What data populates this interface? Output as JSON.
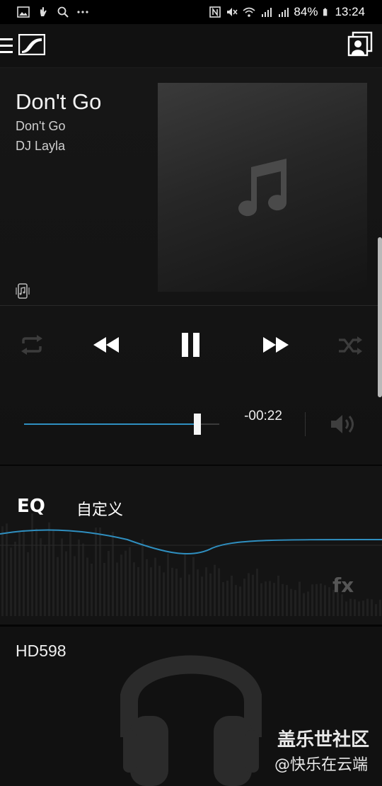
{
  "status_bar": {
    "battery": "84%",
    "time": "13:24",
    "left_icons": [
      "image-icon",
      "hand-icon",
      "search-icon",
      "more-icon"
    ],
    "right_icons": [
      "nfc-icon",
      "mute-icon",
      "wifi-icon",
      "signal-4g-icon",
      "signal-3g-icon",
      "battery-icon"
    ]
  },
  "app_bar": {
    "menu_icon": "menu-icon",
    "logo_icon": "sennheiser-logo-icon",
    "profile_icon": "profile-switch-icon"
  },
  "now_playing": {
    "title": "Don't Go",
    "album": "Don't Go",
    "artist": "DJ Layla",
    "source_icon": "local-music-icon",
    "art_icon": "music-note-icon"
  },
  "controls": {
    "repeat_icon": "repeat-icon",
    "previous_icon": "rewind-icon",
    "play_pause_icon": "pause-icon",
    "next_icon": "fast-forward-icon",
    "shuffle_icon": "shuffle-icon"
  },
  "progress": {
    "fraction": 0.89,
    "time_remaining": "-00:22",
    "volume_icon": "volume-icon"
  },
  "eq": {
    "label": "EQ",
    "preset": "自定义",
    "fx_label": "fx"
  },
  "device": {
    "name": "HD598",
    "image_icon": "headphones-icon"
  },
  "watermark": {
    "line1": "盖乐世社区",
    "line2": "@快乐在云端"
  },
  "colors": {
    "accent": "#2f8fc0",
    "background": "#141414"
  }
}
